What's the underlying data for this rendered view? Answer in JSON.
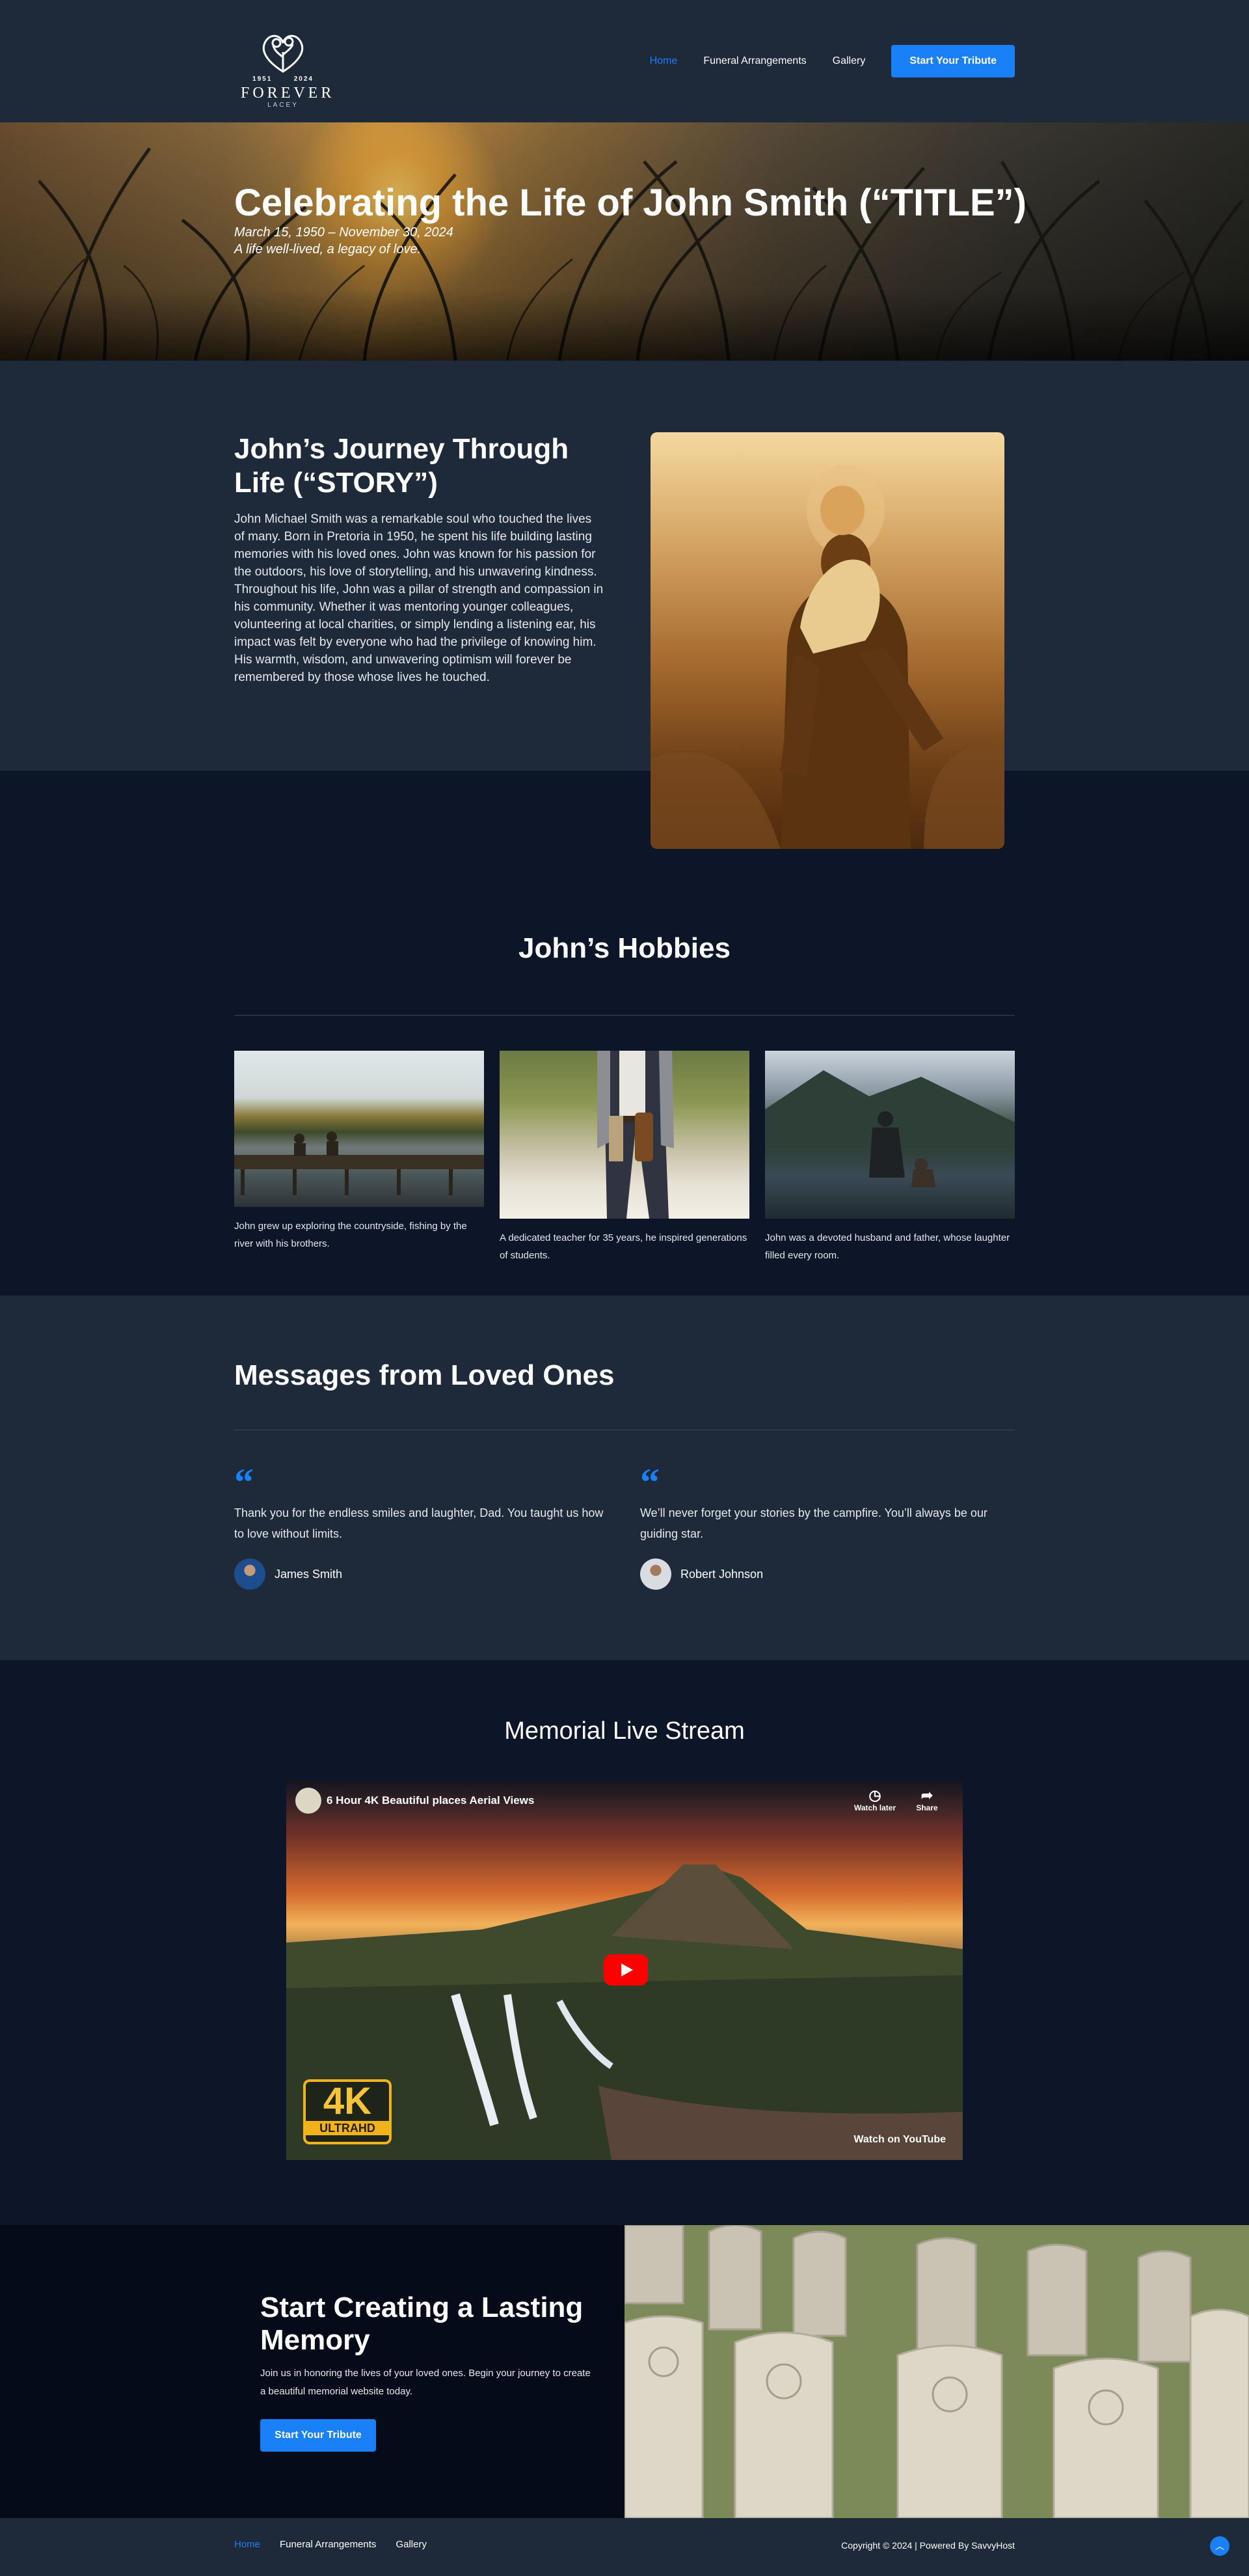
{
  "brand": {
    "year_start": "1951",
    "year_end": "2024",
    "name": "FOREVER",
    "sub": "LACEY"
  },
  "nav": {
    "items": [
      {
        "label": "Home"
      },
      {
        "label": "Funeral Arrangements"
      },
      {
        "label": "Gallery"
      }
    ],
    "cta_label": "Start Your Tribute"
  },
  "hero": {
    "title": "Celebrating the Life of John Smith (“TITLE”)",
    "dates": "March 15, 1950 – November 30, 2024",
    "tagline": "A life well-lived, a legacy of love."
  },
  "story": {
    "title": "John’s Journey Through Life (“STORY”)",
    "paragraph1": "John Michael Smith was a remarkable soul who touched the lives of many. Born in Pretoria in 1950, he spent his life building lasting memories with his loved ones. John was known for his passion for the outdoors, his love of storytelling, and his unwavering kindness.",
    "paragraph2": "Throughout his life, John was a pillar of strength and compassion in his community. Whether it was mentoring younger colleagues, volunteering at local charities, or simply lending a listening ear, his impact was felt by everyone who had the privilege of knowing him. His warmth, wisdom, and unwavering optimism will forever be remembered by those whose lives he touched."
  },
  "hobbies": {
    "title": "John’s Hobbies",
    "items": [
      {
        "caption": "John grew up exploring the countryside, fishing by the river with his brothers."
      },
      {
        "caption": "A dedicated teacher for 35 years, he inspired generations of students."
      },
      {
        "caption": "John was a devoted husband and father, whose laughter filled every room."
      }
    ]
  },
  "messages": {
    "title": "Messages from Loved Ones",
    "quote_mark": "“",
    "items": [
      {
        "text": "Thank you for the endless smiles and laughter, Dad. You taught us how to love without limits.",
        "author": "James Smith"
      },
      {
        "text": "We’ll never forget your stories by the campfire. You’ll always be our guiding star.",
        "author": "Robert Johnson"
      }
    ]
  },
  "livestream": {
    "title": "Memorial Live Stream",
    "video_title": "6 Hour 4K Beautiful places Aerial Views",
    "watch_later": "Watch later",
    "share": "Share",
    "watch_on": "Watch on  YouTube",
    "badge_main": "4K",
    "badge_sub": "ULTRAHD"
  },
  "cta": {
    "title": "Start Creating a Lasting Memory",
    "text": "Join us in honoring the lives of your loved ones. Begin your journey to create a beautiful memorial website today.",
    "button": "Start Your Tribute"
  },
  "footer": {
    "items": [
      {
        "label": "Home"
      },
      {
        "label": "Funeral Arrangements"
      },
      {
        "label": "Gallery"
      }
    ],
    "copyright": "Copyright © 2024 | Powered By SavvyHost"
  },
  "colors": {
    "accent": "#1a80f8",
    "header_bg": "#1e2939",
    "page_bg": "#0d1628"
  },
  "icons": {
    "logo": "heart-tree-logo-icon",
    "quote": "quote-icon",
    "play": "youtube-play-icon",
    "to_top": "chevron-up-icon"
  }
}
